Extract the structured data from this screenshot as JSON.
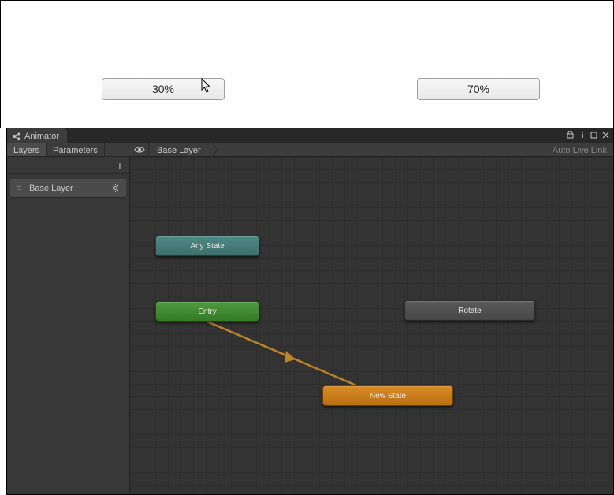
{
  "game_view": {
    "buttons": [
      {
        "label": "30%"
      },
      {
        "label": "70%"
      }
    ]
  },
  "animator": {
    "tab_title": "Animator",
    "toolbar": {
      "layers_label": "Layers",
      "parameters_label": "Parameters",
      "breadcrumb_root": "Base Layer",
      "live_link_label": "Auto Live Link"
    },
    "layers": {
      "add_symbol": "+",
      "items": [
        {
          "name": "Base Layer"
        }
      ]
    },
    "graph": {
      "nodes": {
        "any_state": {
          "label": "Any State"
        },
        "entry": {
          "label": "Entry"
        },
        "new_state": {
          "label": "New State"
        },
        "rotate": {
          "label": "Rotate"
        }
      }
    }
  },
  "colors": {
    "transition": "#c08428"
  }
}
